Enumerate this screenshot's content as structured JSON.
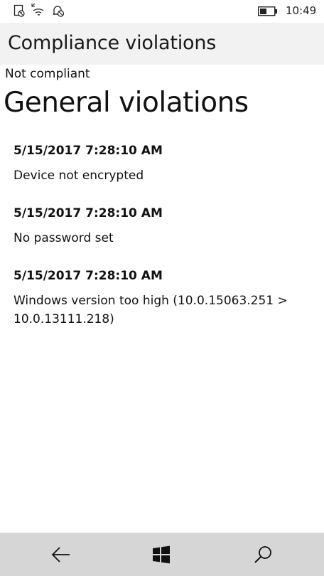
{
  "status_bar": {
    "icons": [
      "alarm-icon",
      "wifi-off-icon",
      "quiet-hours-icon"
    ],
    "battery_icon": "battery-icon",
    "time": "10:49"
  },
  "header": {
    "title": "Compliance violations"
  },
  "main": {
    "compliance_status": "Not compliant",
    "section_title": "General violations",
    "violations": [
      {
        "timestamp": "5/15/2017 7:28:10 AM",
        "description": "Device not encrypted"
      },
      {
        "timestamp": "5/15/2017 7:28:10 AM",
        "description": "No password set"
      },
      {
        "timestamp": "5/15/2017 7:28:10 AM",
        "description": "Windows version too high (10.0.15063.251 > 10.0.13111.218)"
      }
    ]
  },
  "nav_bar": {
    "buttons": [
      "back-icon",
      "windows-icon",
      "search-icon"
    ]
  }
}
